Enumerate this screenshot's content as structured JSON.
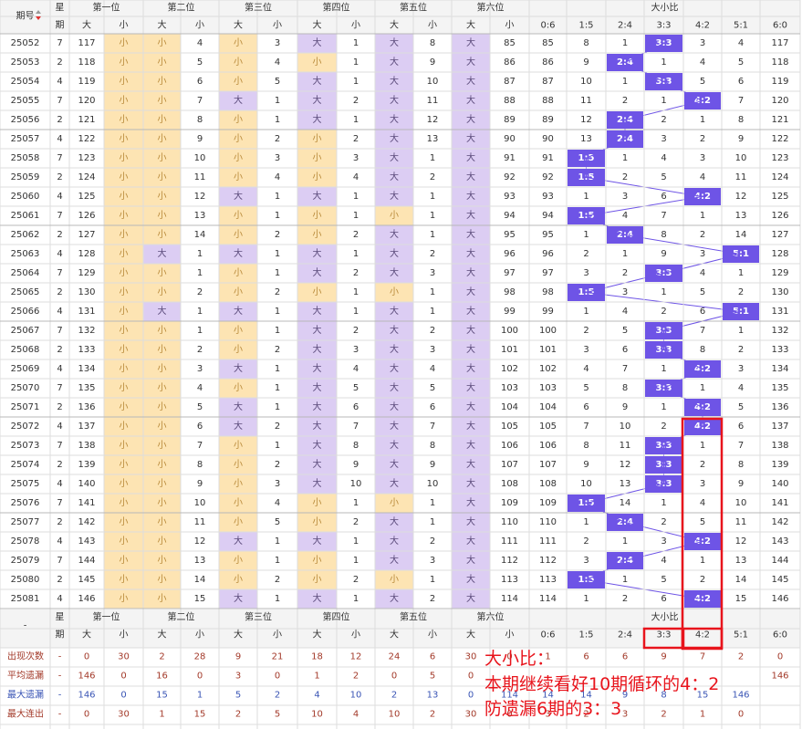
{
  "header": {
    "period_label": "期号",
    "week_label_top": "星",
    "week_label_bottom": "期",
    "positions": [
      "第一位",
      "第二位",
      "第三位",
      "第四位",
      "第五位",
      "第六位"
    ],
    "big": "大",
    "small": "小",
    "ratio_group": "大小比",
    "ratios": [
      "0:6",
      "1:5",
      "2:4",
      "3:3",
      "4:2",
      "5:1",
      "6:0"
    ],
    "footer_dash": "-"
  },
  "colors": {
    "big_cell": "#dccdf3",
    "small_cell": "#fde4b3",
    "ratio_highlight": "#6e54e6",
    "link_line": "#6e54e6",
    "overlay_text": "#e8141c",
    "stats_text": "#a33a2a",
    "stats_blue": "#3a55b5"
  },
  "rows": [
    {
      "id": "25052",
      "week": "7",
      "cells": [
        "117",
        "S",
        "S",
        "4",
        "S",
        "3",
        "B",
        "1",
        "B",
        "8",
        "B",
        "85"
      ],
      "ratio": "3:3",
      "miss": [
        "85",
        "8",
        "1",
        "",
        "3",
        "4",
        "117"
      ]
    },
    {
      "id": "25053",
      "week": "2",
      "cells": [
        "118",
        "S",
        "S",
        "5",
        "S",
        "4",
        "S",
        "1",
        "B",
        "9",
        "B",
        "86"
      ],
      "ratio": "2:4",
      "miss": [
        "86",
        "9",
        "",
        "1",
        "4",
        "5",
        "118"
      ]
    },
    {
      "id": "25054",
      "week": "4",
      "cells": [
        "119",
        "S",
        "S",
        "6",
        "S",
        "5",
        "B",
        "1",
        "B",
        "10",
        "B",
        "87"
      ],
      "ratio": "3:3",
      "miss": [
        "87",
        "10",
        "1",
        "",
        "5",
        "6",
        "119"
      ]
    },
    {
      "id": "25055",
      "week": "7",
      "cells": [
        "120",
        "S",
        "S",
        "7",
        "B",
        "1",
        "B",
        "2",
        "B",
        "11",
        "B",
        "88"
      ],
      "ratio": "4:2",
      "miss": [
        "88",
        "11",
        "2",
        "1",
        "",
        "7",
        "120"
      ]
    },
    {
      "id": "25056",
      "week": "2",
      "cells": [
        "121",
        "S",
        "S",
        "8",
        "S",
        "1",
        "B",
        "1",
        "B",
        "12",
        "B",
        "89"
      ],
      "ratio": "2:4",
      "miss": [
        "89",
        "12",
        "",
        "2",
        "1",
        "8",
        "121"
      ]
    },
    {
      "id": "25057",
      "week": "4",
      "cells": [
        "122",
        "S",
        "S",
        "9",
        "S",
        "2",
        "S",
        "2",
        "B",
        "13",
        "B",
        "90"
      ],
      "ratio": "2:4",
      "miss": [
        "90",
        "13",
        "",
        "3",
        "2",
        "9",
        "122"
      ]
    },
    {
      "id": "25058",
      "week": "7",
      "cells": [
        "123",
        "S",
        "S",
        "10",
        "S",
        "3",
        "S",
        "3",
        "B",
        "1",
        "B",
        "91"
      ],
      "ratio": "1:5",
      "miss": [
        "91",
        "",
        "1",
        "4",
        "3",
        "10",
        "123"
      ]
    },
    {
      "id": "25059",
      "week": "2",
      "cells": [
        "124",
        "S",
        "S",
        "11",
        "S",
        "4",
        "S",
        "4",
        "B",
        "2",
        "B",
        "92"
      ],
      "ratio": "1:5",
      "miss": [
        "92",
        "",
        "2",
        "5",
        "4",
        "11",
        "124"
      ]
    },
    {
      "id": "25060",
      "week": "4",
      "cells": [
        "125",
        "S",
        "S",
        "12",
        "B",
        "1",
        "B",
        "1",
        "B",
        "1",
        "B",
        "93"
      ],
      "ratio": "4:2",
      "miss": [
        "93",
        "1",
        "3",
        "6",
        "",
        "12",
        "125"
      ]
    },
    {
      "id": "25061",
      "week": "7",
      "cells": [
        "126",
        "S",
        "S",
        "13",
        "S",
        "1",
        "S",
        "1",
        "S",
        "1",
        "B",
        "94"
      ],
      "ratio": "1:5",
      "miss": [
        "94",
        "",
        "4",
        "7",
        "1",
        "13",
        "126"
      ]
    },
    {
      "id": "25062",
      "week": "2",
      "cells": [
        "127",
        "S",
        "S",
        "14",
        "S",
        "2",
        "S",
        "2",
        "B",
        "1",
        "B",
        "95"
      ],
      "ratio": "2:4",
      "miss": [
        "95",
        "1",
        "",
        "8",
        "2",
        "14",
        "127"
      ]
    },
    {
      "id": "25063",
      "week": "4",
      "cells": [
        "128",
        "S",
        "B",
        "1",
        "B",
        "1",
        "B",
        "1",
        "B",
        "2",
        "B",
        "96"
      ],
      "ratio": "5:1",
      "miss": [
        "96",
        "2",
        "1",
        "9",
        "3",
        "",
        "128"
      ]
    },
    {
      "id": "25064",
      "week": "7",
      "cells": [
        "129",
        "S",
        "S",
        "1",
        "S",
        "1",
        "B",
        "2",
        "B",
        "3",
        "B",
        "97"
      ],
      "ratio": "3:3",
      "miss": [
        "97",
        "3",
        "2",
        "",
        "4",
        "1",
        "129"
      ]
    },
    {
      "id": "25065",
      "week": "2",
      "cells": [
        "130",
        "S",
        "S",
        "2",
        "S",
        "2",
        "S",
        "1",
        "S",
        "1",
        "B",
        "98"
      ],
      "ratio": "1:5",
      "miss": [
        "98",
        "",
        "3",
        "1",
        "5",
        "2",
        "130"
      ]
    },
    {
      "id": "25066",
      "week": "4",
      "cells": [
        "131",
        "S",
        "B",
        "1",
        "B",
        "1",
        "B",
        "1",
        "B",
        "1",
        "B",
        "99"
      ],
      "ratio": "5:1",
      "miss": [
        "99",
        "1",
        "4",
        "2",
        "6",
        "",
        "131"
      ]
    },
    {
      "id": "25067",
      "week": "7",
      "cells": [
        "132",
        "S",
        "S",
        "1",
        "S",
        "1",
        "B",
        "2",
        "B",
        "2",
        "B",
        "100"
      ],
      "ratio": "3:3",
      "miss": [
        "100",
        "2",
        "5",
        "",
        "7",
        "1",
        "132"
      ]
    },
    {
      "id": "25068",
      "week": "2",
      "cells": [
        "133",
        "S",
        "S",
        "2",
        "S",
        "2",
        "B",
        "3",
        "B",
        "3",
        "B",
        "101"
      ],
      "ratio": "3:3",
      "miss": [
        "101",
        "3",
        "6",
        "",
        "8",
        "2",
        "133"
      ]
    },
    {
      "id": "25069",
      "week": "4",
      "cells": [
        "134",
        "S",
        "S",
        "3",
        "B",
        "1",
        "B",
        "4",
        "B",
        "4",
        "B",
        "102"
      ],
      "ratio": "4:2",
      "miss": [
        "102",
        "4",
        "7",
        "1",
        "",
        "3",
        "134"
      ]
    },
    {
      "id": "25070",
      "week": "7",
      "cells": [
        "135",
        "S",
        "S",
        "4",
        "S",
        "1",
        "B",
        "5",
        "B",
        "5",
        "B",
        "103"
      ],
      "ratio": "3:3",
      "miss": [
        "103",
        "5",
        "8",
        "",
        "1",
        "4",
        "135"
      ]
    },
    {
      "id": "25071",
      "week": "2",
      "cells": [
        "136",
        "S",
        "S",
        "5",
        "B",
        "1",
        "B",
        "6",
        "B",
        "6",
        "B",
        "104"
      ],
      "ratio": "4:2",
      "miss": [
        "104",
        "6",
        "9",
        "1",
        "",
        "5",
        "136"
      ]
    },
    {
      "id": "25072",
      "week": "4",
      "cells": [
        "137",
        "S",
        "S",
        "6",
        "B",
        "2",
        "B",
        "7",
        "B",
        "7",
        "B",
        "105"
      ],
      "ratio": "4:2",
      "miss": [
        "105",
        "7",
        "10",
        "2",
        "",
        "6",
        "137"
      ]
    },
    {
      "id": "25073",
      "week": "7",
      "cells": [
        "138",
        "S",
        "S",
        "7",
        "S",
        "1",
        "B",
        "8",
        "B",
        "8",
        "B",
        "106"
      ],
      "ratio": "3:3",
      "miss": [
        "106",
        "8",
        "11",
        "",
        "1",
        "7",
        "138"
      ]
    },
    {
      "id": "25074",
      "week": "2",
      "cells": [
        "139",
        "S",
        "S",
        "8",
        "S",
        "2",
        "B",
        "9",
        "B",
        "9",
        "B",
        "107"
      ],
      "ratio": "3:3",
      "miss": [
        "107",
        "9",
        "12",
        "",
        "2",
        "8",
        "139"
      ]
    },
    {
      "id": "25075",
      "week": "4",
      "cells": [
        "140",
        "S",
        "S",
        "9",
        "S",
        "3",
        "B",
        "10",
        "B",
        "10",
        "B",
        "108"
      ],
      "ratio": "3:3",
      "miss": [
        "108",
        "10",
        "13",
        "",
        "3",
        "9",
        "140"
      ]
    },
    {
      "id": "25076",
      "week": "7",
      "cells": [
        "141",
        "S",
        "S",
        "10",
        "S",
        "4",
        "S",
        "1",
        "S",
        "1",
        "B",
        "109"
      ],
      "ratio": "1:5",
      "miss": [
        "109",
        "",
        "14",
        "1",
        "4",
        "10",
        "141"
      ]
    },
    {
      "id": "25077",
      "week": "2",
      "cells": [
        "142",
        "S",
        "S",
        "11",
        "S",
        "5",
        "S",
        "2",
        "B",
        "1",
        "B",
        "110"
      ],
      "ratio": "2:4",
      "miss": [
        "110",
        "1",
        "",
        "2",
        "5",
        "11",
        "142"
      ]
    },
    {
      "id": "25078",
      "week": "4",
      "cells": [
        "143",
        "S",
        "S",
        "12",
        "B",
        "1",
        "B",
        "1",
        "B",
        "2",
        "B",
        "111"
      ],
      "ratio": "4:2",
      "miss": [
        "111",
        "2",
        "1",
        "3",
        "",
        "12",
        "143"
      ]
    },
    {
      "id": "25079",
      "week": "7",
      "cells": [
        "144",
        "S",
        "S",
        "13",
        "S",
        "1",
        "S",
        "1",
        "B",
        "3",
        "B",
        "112"
      ],
      "ratio": "2:4",
      "miss": [
        "112",
        "3",
        "",
        "4",
        "1",
        "13",
        "144"
      ]
    },
    {
      "id": "25080",
      "week": "2",
      "cells": [
        "145",
        "S",
        "S",
        "14",
        "S",
        "2",
        "S",
        "2",
        "S",
        "1",
        "B",
        "113"
      ],
      "ratio": "1:5",
      "miss": [
        "113",
        "",
        "1",
        "5",
        "2",
        "14",
        "145"
      ]
    },
    {
      "id": "25081",
      "week": "4",
      "cells": [
        "146",
        "S",
        "S",
        "15",
        "B",
        "1",
        "B",
        "1",
        "B",
        "2",
        "B",
        "114"
      ],
      "ratio": "4:2",
      "miss": [
        "114",
        "1",
        "2",
        "6",
        "",
        "15",
        "146"
      ]
    }
  ],
  "stats": [
    {
      "label": "出现次数",
      "values": [
        "-",
        "0",
        "30",
        "2",
        "28",
        "9",
        "21",
        "18",
        "12",
        "24",
        "6",
        "30",
        "0",
        "1",
        "6",
        "6",
        "9",
        "7",
        "2",
        "0"
      ]
    },
    {
      "label": "平均遗漏",
      "values": [
        "-",
        "146",
        "0",
        "16",
        "0",
        "3",
        "0",
        "1",
        "2",
        "0",
        "5",
        "0",
        "",
        "",
        "",
        "",
        "",
        "",
        "",
        "146"
      ]
    },
    {
      "label": "最大遗漏",
      "values": [
        "-",
        "146",
        "0",
        "15",
        "1",
        "5",
        "2",
        "4",
        "10",
        "2",
        "13",
        "0",
        "114",
        "14",
        "14",
        "9",
        "8",
        "15",
        "146"
      ]
    },
    {
      "label": "最大连出",
      "values": [
        "-",
        "0",
        "30",
        "1",
        "15",
        "2",
        "5",
        "10",
        "4",
        "10",
        "2",
        "30",
        "0",
        "3",
        "2",
        "3",
        "2",
        "1",
        "0"
      ]
    }
  ],
  "annotation": {
    "line1": "大小比：",
    "line2": "本期继续看好10期循环的4：2",
    "line3": "防遗漏6期的3：3"
  }
}
